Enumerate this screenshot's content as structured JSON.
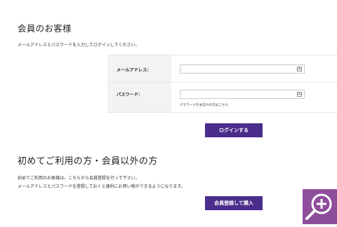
{
  "member": {
    "title": "会員のお客様",
    "description": "メールアドレスとパスワードを入力してログインしてください。",
    "email_label": "メールアドレス：",
    "email_value": "",
    "password_label": "パスワード：",
    "password_value": "",
    "forgot_link": "パスワードをお忘れの方はこちら",
    "login_button": "ログインする"
  },
  "guest": {
    "title": "初めてご利用の方・会員以外の方",
    "description_line1": "初めてご利用のお客様は、こちらから会員登録を行って下さい。",
    "description_line2": "メールアドレスとパスワードを登録しておくと便利にお買い物ができるようになります。",
    "register_button": "会員登録して購入"
  },
  "icons": {
    "input_icon": "password-manager-icon",
    "zoom_icon": "zoom-in-icon"
  },
  "colors": {
    "button": "#4b2d8c",
    "zoom_overlay": "#8f4e9b",
    "label_background": "#f3f3f3"
  }
}
